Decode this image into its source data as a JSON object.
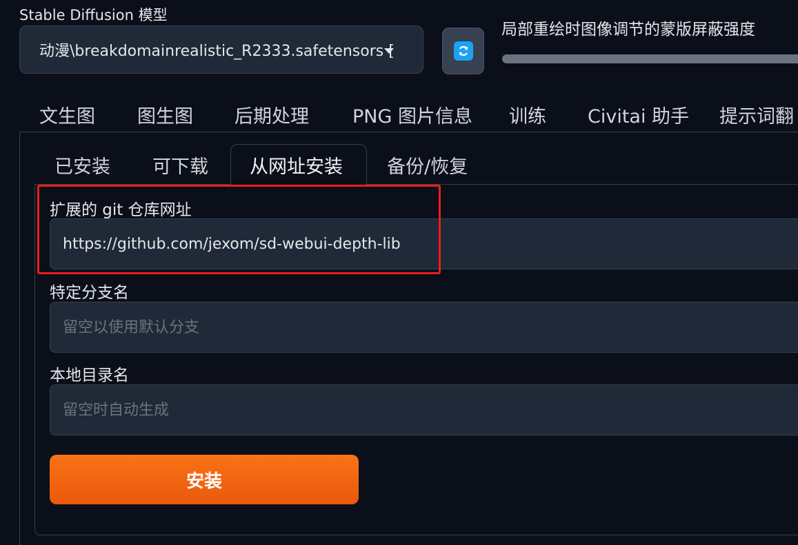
{
  "model": {
    "label": "Stable Diffusion 模型",
    "selected": "动漫\\breakdomainrealistic_R2333.safetensors ["
  },
  "inpaint": {
    "label": "局部重绘时图像调节的蒙版屏蔽强度"
  },
  "icons": {
    "refresh": "refresh-icon",
    "caret": "chevron-down-icon"
  },
  "main_tabs": [
    "文生图",
    "图生图",
    "后期处理",
    "PNG 图片信息",
    "训练",
    "Civitai 助手",
    "提示词翻"
  ],
  "sub_tabs": [
    "已安装",
    "可下载",
    "从网址安装",
    "备份/恢复"
  ],
  "active_sub_tab": "从网址安装",
  "form": {
    "git_url": {
      "label": "扩展的 git 仓库网址",
      "value": "https://github.com/jexom/sd-webui-depth-lib"
    },
    "branch": {
      "label": "特定分支名",
      "placeholder": "留空以使用默认分支"
    },
    "dirname": {
      "label": "本地目录名",
      "placeholder": "留空时自动生成"
    },
    "install_label": "安装"
  },
  "colors": {
    "background": "#0b0f19",
    "accent": "#f97316",
    "highlight": "#ef1c1c",
    "refresh": "#1da1f2"
  }
}
